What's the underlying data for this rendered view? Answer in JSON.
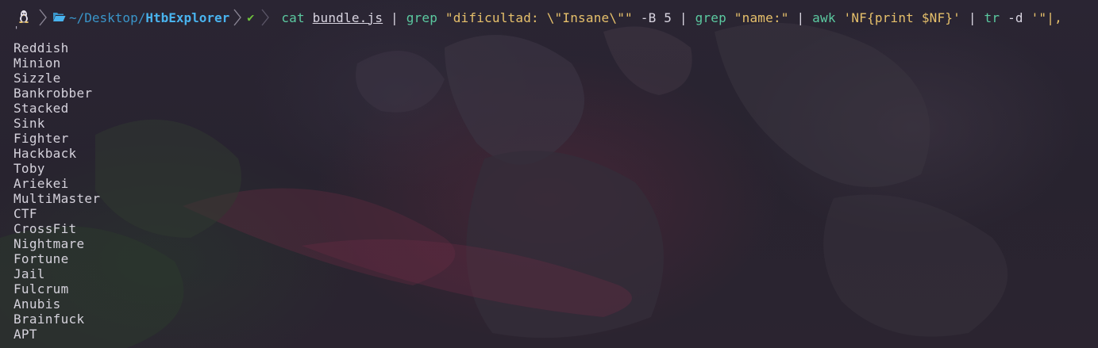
{
  "prompt": {
    "os_icon": "linux-tux-icon",
    "folder_icon": "folder-open-icon",
    "path_prefix": "~/Desktop/",
    "path_current": "HtbExplorer",
    "status_icon": "check-icon",
    "status_glyph": "✔",
    "colors": {
      "path_dim": "#3a95c9",
      "path_bold": "#49b3ee",
      "check": "#6fc23d",
      "command": "#5bc9a0",
      "string": "#e6c06b"
    }
  },
  "command": {
    "cat": "cat",
    "file": "bundle.js",
    "pipe": "|",
    "grep1": "grep",
    "grep1_arg": "\"dificultad: \\\"Insane\\\"\"",
    "grep1_flags": "-B 5",
    "grep2": "grep",
    "grep2_arg": "\"name:\"",
    "awk": "awk",
    "awk_arg": "'NF{print $NF}'",
    "tr": "tr",
    "tr_flags": "-d",
    "tr_arg": "'\"|,"
  },
  "stray_line": "'",
  "output": [
    "Reddish",
    "Minion",
    "Sizzle",
    "Bankrobber",
    "Stacked",
    "Sink",
    "Fighter",
    "Hackback",
    "Toby",
    "Ariekei",
    "MultiMaster",
    "CTF",
    "CrossFit",
    "Nightmare",
    "Fortune",
    "Jail",
    "Fulcrum",
    "Anubis",
    "Brainfuck",
    "APT"
  ]
}
